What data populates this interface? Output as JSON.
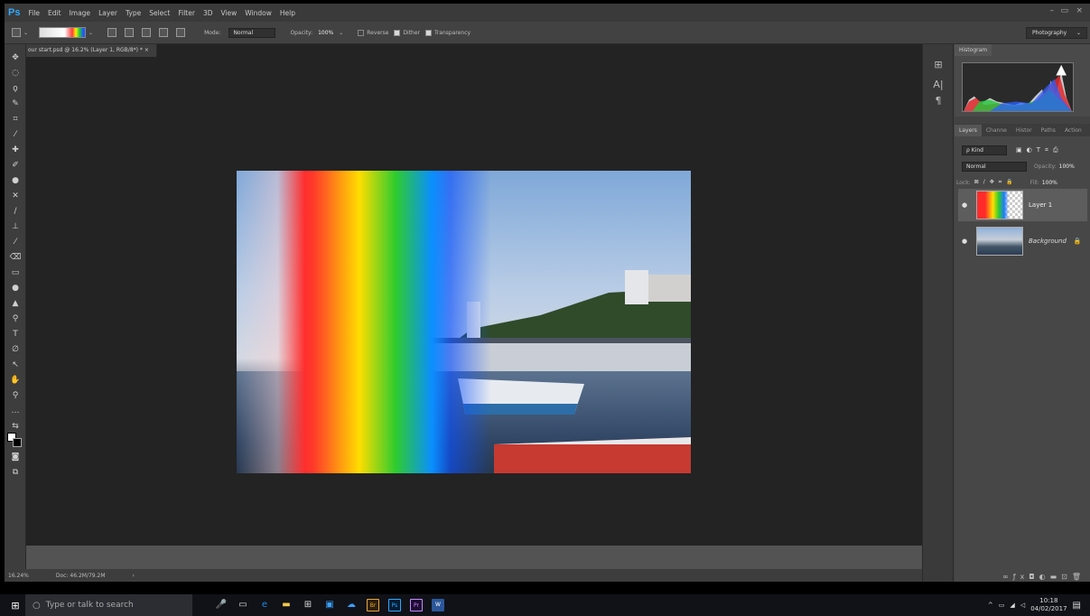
{
  "app": {
    "logo": "Ps",
    "window_controls": [
      "–",
      "▭",
      "×"
    ]
  },
  "menu": [
    "File",
    "Edit",
    "Image",
    "Layer",
    "Type",
    "Select",
    "Filter",
    "3D",
    "View",
    "Window",
    "Help"
  ],
  "options": {
    "mode_label": "Mode:",
    "mode_value": "Normal",
    "opacity_label": "Opacity:",
    "opacity_value": "100%",
    "reverse_label": "Reverse",
    "dither_label": "Dither",
    "transparency_label": "Transparency",
    "reverse_checked": false,
    "dither_checked": true,
    "transparency_checked": true
  },
  "workspace": "Photography",
  "document": {
    "tab_title": "our start.psd @ 16.2% (Layer 1, RGB/8*) *",
    "close": "×"
  },
  "panels": {
    "histogram_tab": "Histogram",
    "layer_tabs": [
      "Layers",
      "Channe",
      "Histor",
      "Paths",
      "Action"
    ],
    "kind_label": "ρ Kind",
    "blend_mode": "Normal",
    "opacity_label": "Opacity:",
    "opacity_value": "100%",
    "lock_label": "Lock:",
    "fill_label": "Fill:",
    "fill_value": "100%"
  },
  "layers": [
    {
      "name": "Layer 1"
    },
    {
      "name": "Background",
      "locked": true
    }
  ],
  "status": {
    "zoom": "16.24%",
    "doc": "Doc: 46.2M/79.2M",
    "arrow": "›"
  },
  "taskbar": {
    "search_placeholder": "Type or talk to search",
    "time": "10:18",
    "date": "04/02/2017"
  },
  "colors": {
    "accent": "#31a8ff",
    "panel": "#424242",
    "workspace_bg": "#232323"
  }
}
